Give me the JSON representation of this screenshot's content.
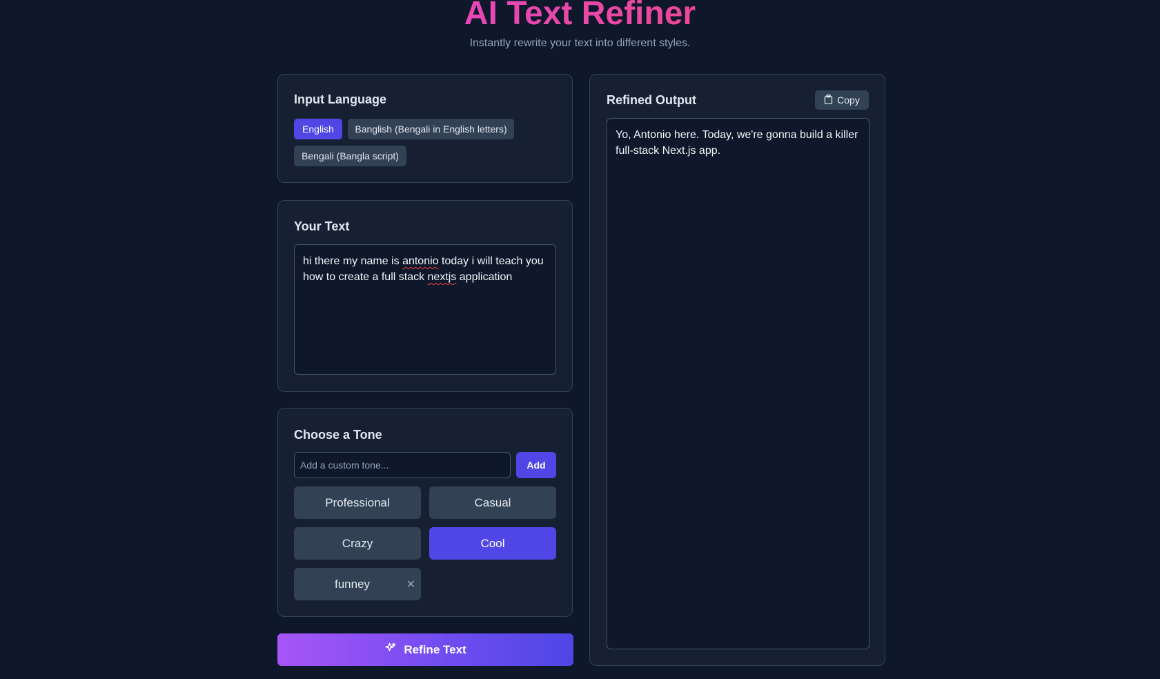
{
  "header": {
    "title": "AI Text Refiner",
    "subtitle": "Instantly rewrite your text into different styles."
  },
  "language": {
    "title": "Input Language",
    "options": [
      "English",
      "Banglish (Bengali in English letters)",
      "Bengali (Bangla script)"
    ],
    "selected": "English"
  },
  "input": {
    "title": "Your Text",
    "text_parts": [
      "hi there my name is ",
      "antonio",
      " today i will teach you how to create a full stack ",
      "nextjs",
      " application"
    ]
  },
  "tone": {
    "title": "Choose a Tone",
    "custom_placeholder": "Add a custom tone...",
    "add_label": "Add",
    "options": [
      "Professional",
      "Casual",
      "Crazy",
      "Cool",
      "funney"
    ],
    "selected": "Cool",
    "remove_icon": "close-icon"
  },
  "refine": {
    "label": "Refine Text",
    "icon": "sparkles-icon"
  },
  "output": {
    "title": "Refined Output",
    "copy_label": "Copy",
    "copy_icon": "clipboard-icon",
    "text": "Yo, Antonio here. Today, we're gonna build a killer full-stack Next.js app."
  },
  "colors": {
    "accent": "#4f46e5",
    "background": "#0f172a",
    "card": "#172033"
  }
}
